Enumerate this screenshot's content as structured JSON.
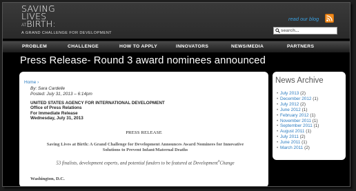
{
  "header": {
    "logo_line1": "SAVING",
    "logo_line2": "LIVES",
    "logo_at": "AT",
    "logo_line3": "BIRTH:",
    "logo_tagline": "A GRAND CHALLENGE FOR DEVELOPMENT",
    "blog_link": "read our blog",
    "rss_icon": "rss-feed-icon",
    "search_placeholder": "search...",
    "search_icon": "magnifier-icon"
  },
  "nav": {
    "items": [
      {
        "label": "PROBLEM"
      },
      {
        "label": "CHALLENGE"
      },
      {
        "label": "HOW TO APPLY"
      },
      {
        "label": "INNOVATORS"
      },
      {
        "label": "NEWS/MEDIA"
      },
      {
        "label": "PARTNERS"
      }
    ]
  },
  "page": {
    "title": "Press Release- Round 3 award nominees announced"
  },
  "article": {
    "breadcrumb": "Home ›",
    "author": "By: Sara Cardelle",
    "posted": "Posted: July 31, 2013 – 6:14pm",
    "agency": "UNITED STATES AGENCY FOR INTERNATIONAL DEVELOPMENT",
    "office": "Office of Press Relations",
    "release_type": "For Immediate Release",
    "date": "Wednesday, July 31, 2013",
    "heading": "PRESS RELEASE",
    "headline_1": "Saving Lives at Birth: A Grand Challenge for Development Announces Award Nominees for Innovative",
    "headline_2": "Solutions to Prevent Infant/Maternal Deaths",
    "subhead": "53 finalists, development experts, and potential funders to be featured at Development",
    "subhead_sup": "X",
    "subhead_end": "Change",
    "dateline": "Washington, D.C."
  },
  "sidebar": {
    "title": "News Archive",
    "archive": [
      {
        "month": "July 2013",
        "count": "(2)"
      },
      {
        "month": "December 2012",
        "count": "(1)"
      },
      {
        "month": "July 2012",
        "count": "(2)"
      },
      {
        "month": "June 2012",
        "count": "(1)"
      },
      {
        "month": "February 2012",
        "count": "(1)"
      },
      {
        "month": "November 2011",
        "count": "(1)"
      },
      {
        "month": "September 2011",
        "count": "(1)"
      },
      {
        "month": "August 2011",
        "count": "(1)"
      },
      {
        "month": "July 2011",
        "count": "(2)"
      },
      {
        "month": "June 2011",
        "count": "(1)"
      },
      {
        "month": "March 2011",
        "count": "(2)"
      }
    ]
  },
  "colors": {
    "link": "#2a7bc0",
    "blog_link": "#3aa0e0",
    "rss": "#f28a1b",
    "background": "#000000"
  }
}
